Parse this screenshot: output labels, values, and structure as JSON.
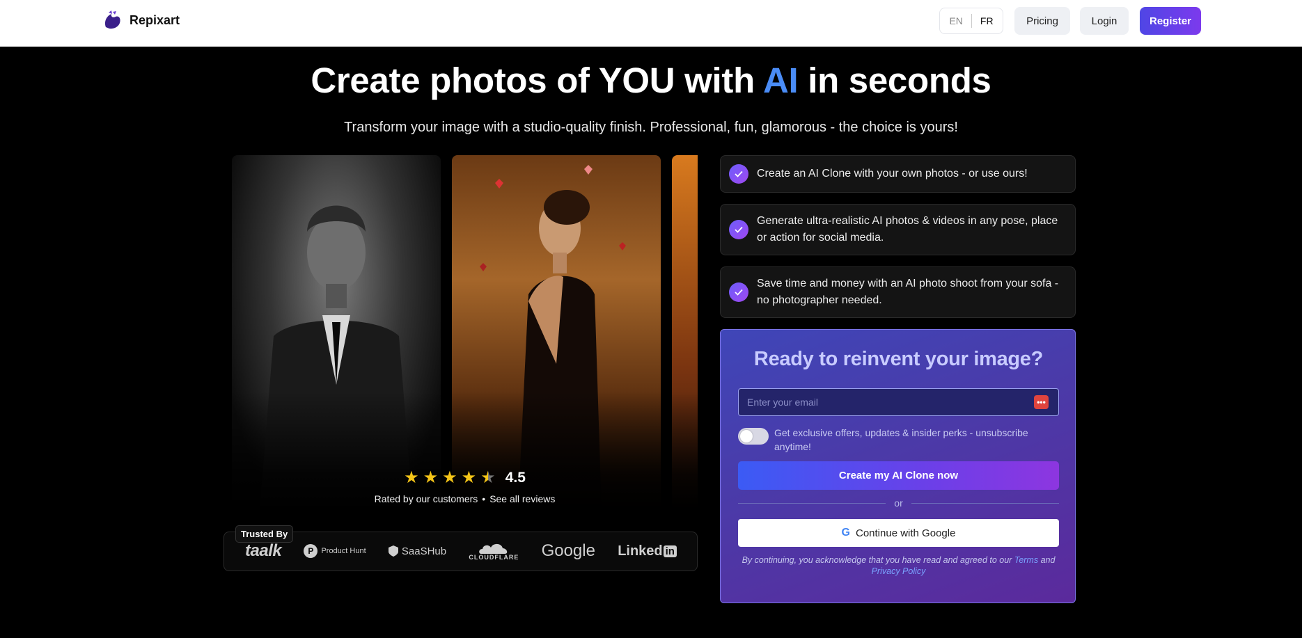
{
  "header": {
    "brand": "Repixart",
    "lang_en": "EN",
    "lang_fr": "FR",
    "pricing": "Pricing",
    "login": "Login",
    "register": "Register"
  },
  "hero": {
    "title_before": "Create photos of YOU with ",
    "title_highlight": "AI",
    "title_after": " in seconds",
    "subtitle": "Transform your image with a studio-quality finish. Professional, fun, glamorous - the choice is yours!"
  },
  "rating": {
    "value": "4.5",
    "stars": 4.5,
    "caption": "Rated by our customers",
    "separator": "•",
    "reviews_link": "See all reviews"
  },
  "trusted": {
    "label": "Trusted By",
    "logos": {
      "taalk": "taalk",
      "producthunt_letter": "P",
      "producthunt": "Product Hunt",
      "saashub": "SaaSHub",
      "cloudflare": "CLOUDFLARE",
      "google": "Google",
      "linkedin_text": "Linked",
      "linkedin_in": "in"
    }
  },
  "features": [
    {
      "text": "Create an AI Clone with your own photos - or use ours!"
    },
    {
      "text": "Generate ultra-realistic AI photos & videos in any pose, place or action for social media."
    },
    {
      "text": "Save time and money with an AI photo shoot from your sofa - no photographer needed."
    }
  ],
  "signup": {
    "title": "Ready to reinvent your image?",
    "email_placeholder": "Enter your email",
    "password_icon": "•••",
    "optin": "Get exclusive offers, updates & insider perks - unsubscribe anytime!",
    "cta": "Create my AI Clone now",
    "or": "or",
    "google_letter": "G",
    "google": "Continue with Google",
    "legal_prefix": "By continuing, you acknowledge that you have read and agreed to our",
    "terms": "Terms",
    "and": "and",
    "privacy": "Privacy Policy"
  },
  "colors": {
    "accent": "#4a8cf6",
    "star": "#f5c518",
    "register_from": "#4f46e5",
    "register_to": "#7c3aed"
  },
  "icons": [
    "repixart-logo-icon",
    "check-icon",
    "star-icon",
    "password-manager-icon",
    "google-icon",
    "producthunt-icon",
    "saashub-icon",
    "cloudflare-icon",
    "linkedin-icon"
  ]
}
